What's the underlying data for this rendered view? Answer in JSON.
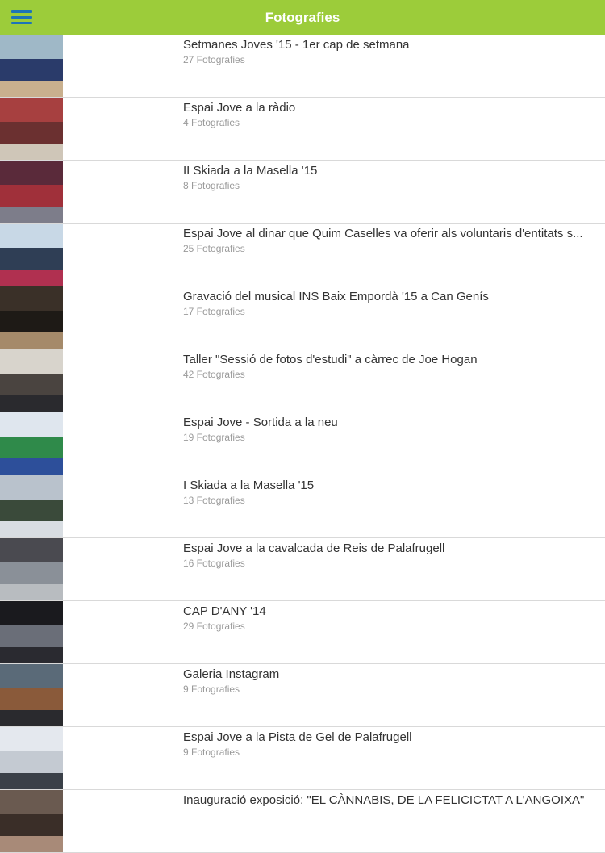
{
  "header": {
    "title": "Fotografies",
    "menu_icon": "hamburger-menu-icon",
    "bar_color": "#9ccc3a",
    "menu_color": "#1d74b8"
  },
  "albums": [
    {
      "title": "Setmanes Joves '15 - 1er cap de setmana",
      "count": "27 Fotografies",
      "thumb": [
        "#9fb8c7",
        "#2a3b6a",
        "#c9b08e"
      ]
    },
    {
      "title": "Espai Jove a la ràdio",
      "count": "4 Fotografies",
      "thumb": [
        "#a74040",
        "#6b3030",
        "#cfc6b8"
      ]
    },
    {
      "title": "II Skiada a la Masella '15",
      "count": "8 Fotografies",
      "thumb": [
        "#5a2a3a",
        "#a0303a",
        "#7d7d8a"
      ]
    },
    {
      "title": "Espai Jove al dinar que Quim Caselles va oferir als voluntaris d'entitats s...",
      "count": "25 Fotografies",
      "thumb": [
        "#c8d8e6",
        "#2f3e55",
        "#b03050"
      ]
    },
    {
      "title": "Gravació del musical INS Baix Empordà '15 a Can Genís",
      "count": "17 Fotografies",
      "thumb": [
        "#3a3028",
        "#1e1a16",
        "#a58a6a"
      ]
    },
    {
      "title": "Taller \"Sessió de fotos d'estudi\" a càrrec de Joe Hogan",
      "count": "42 Fotografies",
      "thumb": [
        "#d8d4cc",
        "#4a4440",
        "#2a2a2e"
      ]
    },
    {
      "title": "Espai Jove - Sortida a la neu",
      "count": "19 Fotografies",
      "thumb": [
        "#dfe6ee",
        "#2f8a4a",
        "#2d4f9a"
      ]
    },
    {
      "title": "I Skiada a la Masella '15",
      "count": "13 Fotografies",
      "thumb": [
        "#b9c2cc",
        "#3a4a3a",
        "#d8dde2"
      ]
    },
    {
      "title": "Espai Jove a la cavalcada de Reis de Palafrugell",
      "count": "16 Fotografies",
      "thumb": [
        "#4a4a50",
        "#8a9098",
        "#b8bcc0"
      ]
    },
    {
      "title": "CAP D'ANY '14",
      "count": "29 Fotografies",
      "thumb": [
        "#1a1a1e",
        "#6a6e78",
        "#2a2a30"
      ]
    },
    {
      "title": "Galeria Instagram",
      "count": "9 Fotografies",
      "thumb": [
        "#5a6a78",
        "#8a5a3a",
        "#2a2a2e"
      ]
    },
    {
      "title": "Espai Jove a la Pista de Gel de Palafrugell",
      "count": "9 Fotografies",
      "thumb": [
        "#e4e8ee",
        "#c4cad2",
        "#3a4048"
      ]
    },
    {
      "title": "Inauguració exposició: \"EL CÀNNABIS, DE LA FELICICTAT A L'ANGOIXA\"",
      "count": "",
      "thumb": [
        "#6a5a50",
        "#3a2e28",
        "#a88a78"
      ]
    }
  ]
}
